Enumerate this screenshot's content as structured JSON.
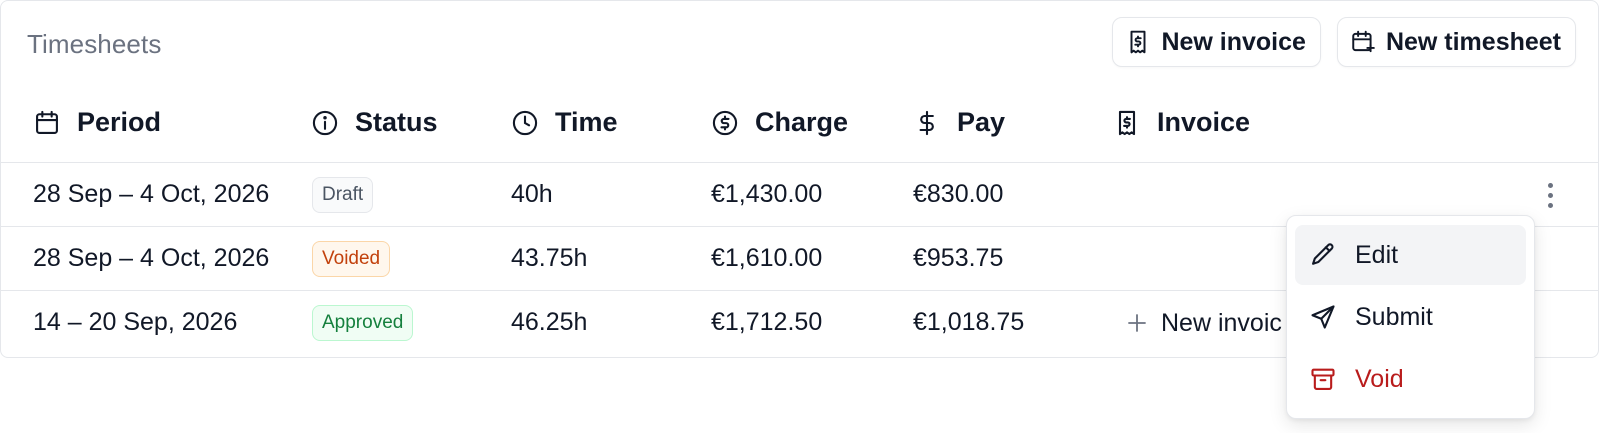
{
  "header": {
    "title": "Timesheets",
    "new_invoice_label": "New invoice",
    "new_timesheet_label": "New timesheet"
  },
  "table": {
    "columns": [
      {
        "key": "period",
        "label": "Period",
        "icon": "calendar-icon"
      },
      {
        "key": "status",
        "label": "Status",
        "icon": "info-circle-icon"
      },
      {
        "key": "time",
        "label": "Time",
        "icon": "clock-icon"
      },
      {
        "key": "charge",
        "label": "Charge",
        "icon": "dollar-circle-icon"
      },
      {
        "key": "pay",
        "label": "Pay",
        "icon": "dollar-sign-icon"
      },
      {
        "key": "invoice",
        "label": "Invoice",
        "icon": "receipt-icon"
      }
    ],
    "rows": [
      {
        "period": "28 Sep – 4 Oct, 2026",
        "status": "Draft",
        "time": "40h",
        "charge": "€1,430.00",
        "pay": "€830.00",
        "invoice": ""
      },
      {
        "period": "28 Sep – 4 Oct, 2026",
        "status": "Voided",
        "time": "43.75h",
        "charge": "€1,610.00",
        "pay": "€953.75",
        "invoice": ""
      },
      {
        "period": "14 – 20 Sep, 2026",
        "status": "Approved",
        "time": "46.25h",
        "charge": "€1,712.50",
        "pay": "€1,018.75",
        "invoice": "New invoic"
      }
    ]
  },
  "row_menu": {
    "items": [
      {
        "label": "Edit",
        "icon": "pencil-icon"
      },
      {
        "label": "Submit",
        "icon": "send-icon"
      },
      {
        "label": "Void",
        "icon": "archive-icon"
      }
    ]
  },
  "colors": {
    "draft": "#4b5563",
    "voided": "#c2410c",
    "approved": "#15803d",
    "danger": "#b91c1c",
    "muted": "#6b7280",
    "border": "#e5e7eb"
  }
}
